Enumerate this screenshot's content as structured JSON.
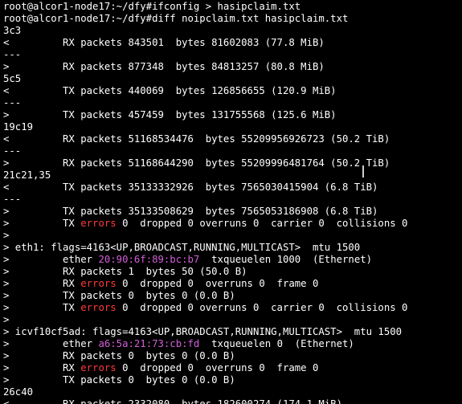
{
  "terminal": {
    "colors": {
      "background": "#000000",
      "text": "#ffffff",
      "error_text": "#ff3b3b",
      "mac_address": "#d25fd8"
    },
    "lines": [
      [
        {
          "t": "root@alcor1-node17:~/dfy#ifconfig > hasipclaim.txt"
        }
      ],
      [
        {
          "t": "root@alcor1-node17:~/dfy#diff noipclaim.txt hasipclaim.txt"
        }
      ],
      [
        {
          "t": "3c3"
        }
      ],
      [
        {
          "t": "<         RX packets 843501  bytes 81602083 (77.8 MiB)"
        }
      ],
      [
        {
          "t": "---"
        }
      ],
      [
        {
          "t": ">         RX packets 877348  bytes 84813257 (80.8 MiB)"
        }
      ],
      [
        {
          "t": "5c5"
        }
      ],
      [
        {
          "t": "<         TX packets 440069  bytes 126856655 (120.9 MiB)"
        }
      ],
      [
        {
          "t": "---"
        }
      ],
      [
        {
          "t": ">         TX packets 457459  bytes 131755568 (125.6 MiB)"
        }
      ],
      [
        {
          "t": "19c19"
        }
      ],
      [
        {
          "t": "<         RX packets 51168534476  bytes 55209956926723 (50.2 TiB)"
        }
      ],
      [
        {
          "t": "---"
        }
      ],
      [
        {
          "t": ">         RX packets 51168644290  bytes 55209996481764 (50.2 TiB)"
        }
      ],
      [
        {
          "t": "21c21,35"
        }
      ],
      [
        {
          "t": "<         TX packets 35133332926  bytes 7565030415904 (6.8 TiB)"
        }
      ],
      [
        {
          "t": "---"
        }
      ],
      [
        {
          "t": ">         TX packets 35133508629  bytes 7565053186908 (6.8 TiB)"
        }
      ],
      [
        {
          "t": ">         TX "
        },
        {
          "t": "errors",
          "c": "red"
        },
        {
          "t": " 0  dropped 0 overruns 0  carrier 0  collisions 0"
        }
      ],
      [
        {
          "t": ">"
        }
      ],
      [
        {
          "t": "> eth1: flags=4163<UP,BROADCAST,RUNNING,MULTICAST>  mtu 1500"
        }
      ],
      [
        {
          "t": ">         ether "
        },
        {
          "t": "20:90:6f:89:bc:b7",
          "c": "mag"
        },
        {
          "t": "  txqueuelen 1000  (Ethernet)"
        }
      ],
      [
        {
          "t": ">         RX packets 1  bytes 50 (50.0 B)"
        }
      ],
      [
        {
          "t": ">         RX "
        },
        {
          "t": "errors",
          "c": "red"
        },
        {
          "t": " 0  dropped 0  overruns 0  frame 0"
        }
      ],
      [
        {
          "t": ">         TX packets 0  bytes 0 (0.0 B)"
        }
      ],
      [
        {
          "t": ">         TX "
        },
        {
          "t": "errors",
          "c": "red"
        },
        {
          "t": " 0  dropped 0 overruns 0  carrier 0  collisions 0"
        }
      ],
      [
        {
          "t": ">"
        }
      ],
      [
        {
          "t": "> icvf10cf5ad: flags=4163<UP,BROADCAST,RUNNING,MULTICAST>  mtu 1500"
        }
      ],
      [
        {
          "t": ">         ether "
        },
        {
          "t": "a6:5a:21:73:cb:fd",
          "c": "mag"
        },
        {
          "t": "  txqueuelen 0  (Ethernet)"
        }
      ],
      [
        {
          "t": ">         RX packets 0  bytes 0 (0.0 B)"
        }
      ],
      [
        {
          "t": ">         RX "
        },
        {
          "t": "errors",
          "c": "red"
        },
        {
          "t": " 0  dropped 0  overruns 0  frame 0"
        }
      ],
      [
        {
          "t": ">         TX packets 0  bytes 0 (0.0 B)"
        }
      ],
      [
        {
          "t": "26c40"
        }
      ],
      [
        {
          "t": "<         RX packets 2332080  bytes 182600274 (174.1 MiB)"
        }
      ]
    ]
  }
}
